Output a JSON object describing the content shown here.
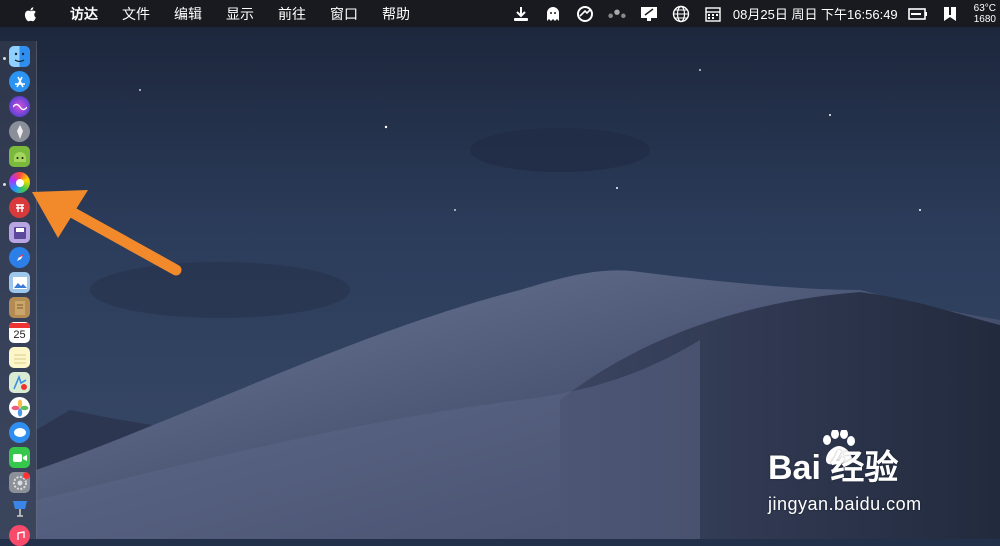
{
  "menubar": {
    "app_name": "访达",
    "items": [
      "文件",
      "编辑",
      "显示",
      "前往",
      "窗口",
      "帮助"
    ],
    "datetime": "08月25日 周日 下午16:56:49",
    "temperature": "63°C",
    "fan_speed": "1680"
  },
  "dock": {
    "apps": [
      "finder",
      "app-store",
      "siri",
      "launchpad",
      "android-studio",
      "color-app",
      "toolbox",
      "floppy-app",
      "safari",
      "preview",
      "notes-book",
      "calendar",
      "notes",
      "maps",
      "photos",
      "messages",
      "facetime",
      "system-preferences",
      "keynote",
      "music"
    ],
    "calendar_day": "25"
  },
  "watermark": {
    "logo_text": "Bai 经验",
    "url": "jingyan.baidu.com"
  },
  "colors": {
    "menubar_bg": "#181a1f",
    "sky": "#2a3b5a",
    "arrow": "#f28a2c"
  }
}
